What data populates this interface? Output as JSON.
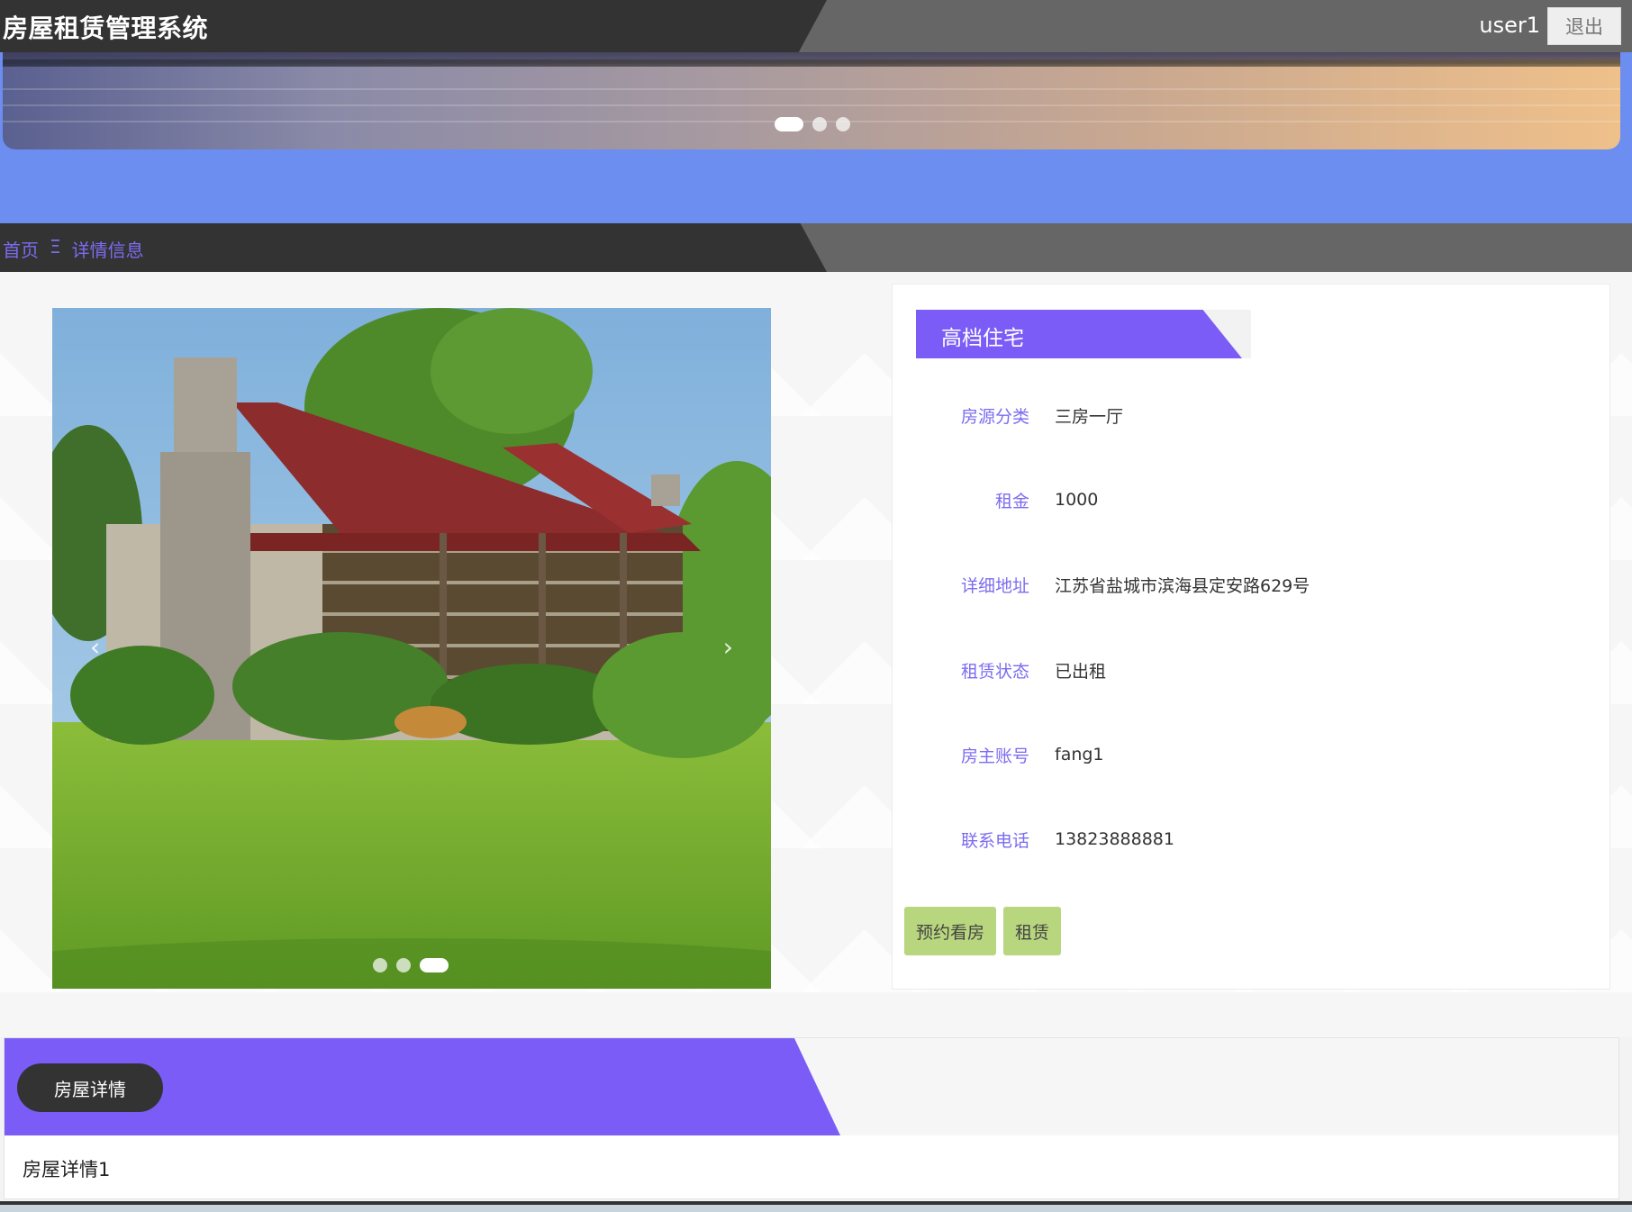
{
  "header": {
    "app_title": "房屋租赁管理系统",
    "username": "user1",
    "logout_label": "退出"
  },
  "banner": {
    "slides": 3,
    "active_slide": 1
  },
  "breadcrumb": {
    "home": "首页",
    "separator": "Ξ",
    "current": "详情信息"
  },
  "gallery": {
    "slides": 3,
    "active_slide": 3,
    "prev_icon": "‹",
    "next_icon": "›"
  },
  "house": {
    "title": "高档住宅",
    "fields": [
      {
        "label": "房源分类",
        "value": "三房一厅"
      },
      {
        "label": "租金",
        "value": "1000"
      },
      {
        "label": "详细地址",
        "value": "江苏省盐城市滨海县定安路629号"
      },
      {
        "label": "租赁状态",
        "value": "已出租"
      },
      {
        "label": "房主账号",
        "value": "fang1"
      },
      {
        "label": "联系电话",
        "value": "13823888881"
      }
    ],
    "actions": {
      "book_viewing": "预约看房",
      "rent": "租赁"
    }
  },
  "detail": {
    "tab_label": "房屋详情",
    "content": "房屋详情1"
  },
  "colors": {
    "accent_purple": "#7b5cf6",
    "link_purple": "#7b6cf0",
    "banner_blue": "#6b8ef0",
    "button_green": "#b8d67d",
    "dark_bar": "#333333",
    "grey_bar": "#666666"
  }
}
